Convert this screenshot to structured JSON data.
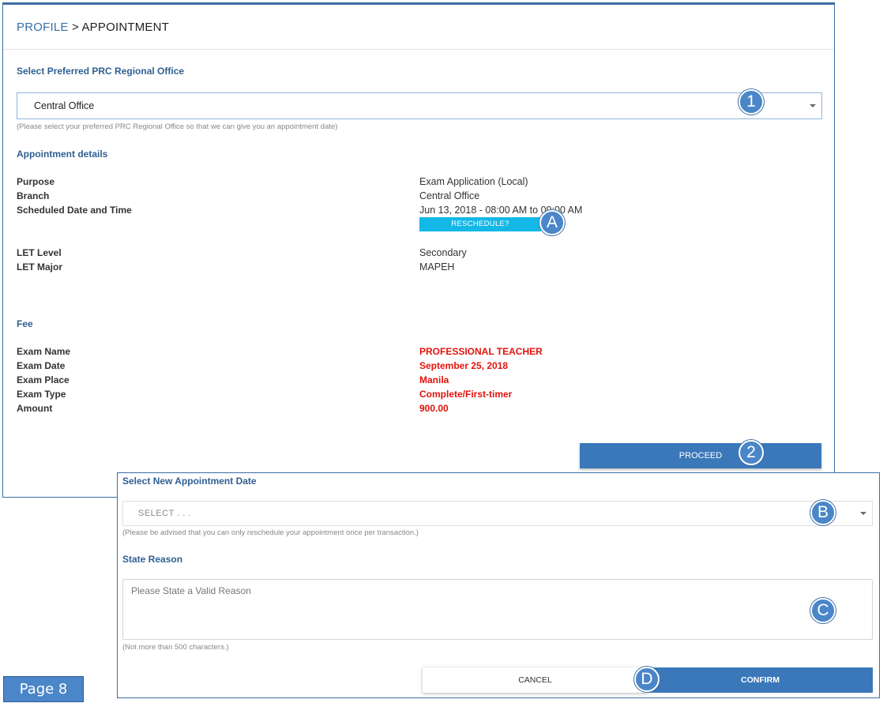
{
  "breadcrumb": {
    "link": "PROFILE",
    "separator": " > ",
    "current": "APPOINTMENT"
  },
  "office": {
    "section_title": "Select Preferred PRC Regional Office",
    "selected": "Central Office",
    "hint": "(Please select your preferred PRC Regional Office so that we can give you an appointment date)"
  },
  "appointment": {
    "section_title": "Appointment details",
    "purpose_label": "Purpose",
    "purpose_value": "Exam Application (Local)",
    "branch_label": "Branch",
    "branch_value": "Central Office",
    "schedule_label": "Scheduled Date and Time",
    "schedule_value": "Jun 13, 2018 - 08:00 AM to 09:00 AM",
    "reschedule_label": "RESCHEDULE?",
    "let_level_label": "LET Level",
    "let_level_value": "Secondary",
    "let_major_label": "LET Major",
    "let_major_value": "MAPEH"
  },
  "fee": {
    "section_title": "Fee",
    "exam_name_label": "Exam Name",
    "exam_name_value": "PROFESSIONAL TEACHER",
    "exam_date_label": "Exam Date",
    "exam_date_value": "September 25, 2018",
    "exam_place_label": "Exam Place",
    "exam_place_value": "Manila",
    "exam_type_label": "Exam Type",
    "exam_type_value": "Complete/First-timer",
    "amount_label": "Amount",
    "amount_value": "900.00"
  },
  "proceed_label": "PROCEED",
  "reschedule_dialog": {
    "date_title": "Select New Appointment Date",
    "date_placeholder": "SELECT . . .",
    "date_hint": "(Please be advised that you can only reschedule your appointment once per transaction.)",
    "reason_title": "State Reason",
    "reason_placeholder": "Please State a Valid Reason",
    "reason_hint": "(Not more than 500 characters.)",
    "cancel_label": "CANCEL",
    "confirm_label": "CONFIRM"
  },
  "markers": {
    "m1": "1",
    "m2": "2",
    "mA": "A",
    "mB": "B",
    "mC": "C",
    "mD": "D"
  },
  "page_label": "Page 8",
  "colors": {
    "accent": "#3a78b9",
    "reschedule": "#14b8e6",
    "fee_text": "#e3120b",
    "marker": "#4a86c8"
  }
}
